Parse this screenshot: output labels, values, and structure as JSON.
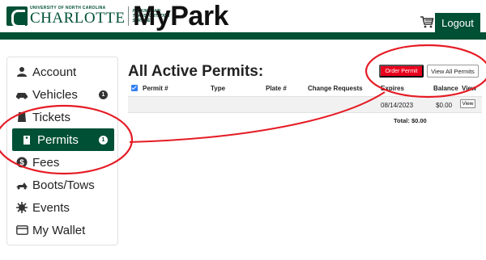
{
  "header": {
    "logo_small": "UNIVERSITY OF NORTH CAROLINA",
    "logo_big": "CHARLOTTE",
    "logo_dept": [
      "PARKING AND",
      "TRANSPORTATION",
      "SERVICES"
    ],
    "app_title": "MyPark",
    "cart_icon": "shopping-cart-icon",
    "logout_label": "Logout"
  },
  "colors": {
    "brand_green": "#005035",
    "order_red": "#e8001c",
    "annotation_red": "#e51b24"
  },
  "sidebar": {
    "items": [
      {
        "label": "Account",
        "icon": "user-icon",
        "badge": ""
      },
      {
        "label": "Vehicles",
        "icon": "car-icon",
        "badge": "1"
      },
      {
        "label": "Tickets",
        "icon": "ticket-icon",
        "badge": ""
      },
      {
        "label": "Permits",
        "icon": "permit-tag-icon",
        "badge": "1",
        "active": true
      },
      {
        "label": "Fees",
        "icon": "dollar-icon",
        "badge": ""
      },
      {
        "label": "Boots/Tows",
        "icon": "tow-truck-icon",
        "badge": ""
      },
      {
        "label": "Events",
        "icon": "events-icon",
        "badge": ""
      },
      {
        "label": "My Wallet",
        "icon": "wallet-icon",
        "badge": ""
      }
    ]
  },
  "main": {
    "title": "All Active Permits:",
    "order_permit_label": "Order Permit",
    "view_all_label": "View All Permits",
    "columns": [
      "Permit #",
      "Type",
      "Plate #",
      "Change Requests",
      "Expires",
      "Balance",
      "View"
    ],
    "rows": [
      {
        "permit": "",
        "type": "",
        "plate": "",
        "change_requests": "",
        "expires": "08/14/2023",
        "balance": "$0.00",
        "view_label": "View"
      }
    ],
    "total": "Total: $0.00"
  }
}
